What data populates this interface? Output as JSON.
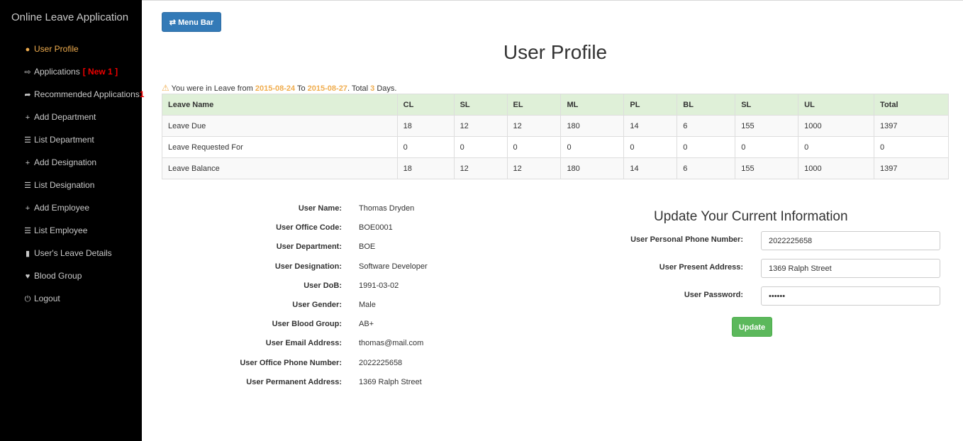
{
  "app": {
    "title": "Online Leave Application"
  },
  "sidebar": {
    "items": [
      {
        "icon": "user-circle-icon",
        "glyph": "●",
        "label": "User Profile",
        "active": true
      },
      {
        "icon": "sign-out-icon",
        "glyph": "⇨",
        "label": "Applications",
        "badge": "[ New 1 ]"
      },
      {
        "icon": "share-icon",
        "glyph": "➦",
        "label": "Recommended Applications",
        "count": "1"
      },
      {
        "icon": "plus-icon",
        "glyph": "+",
        "label": "Add Department"
      },
      {
        "icon": "list-icon",
        "glyph": "☰",
        "label": "List Department"
      },
      {
        "icon": "plus-icon",
        "glyph": "+",
        "label": "Add Designation"
      },
      {
        "icon": "list-icon",
        "glyph": "☰",
        "label": "List Designation"
      },
      {
        "icon": "plus-icon",
        "glyph": "+",
        "label": "Add Employee"
      },
      {
        "icon": "list-icon",
        "glyph": "☰",
        "label": "List Employee"
      },
      {
        "icon": "clipboard-icon",
        "glyph": "▮",
        "label": "User's Leave Details"
      },
      {
        "icon": "heartbeat-icon",
        "glyph": "♥",
        "label": "Blood Group"
      },
      {
        "icon": "power-icon",
        "glyph": "⏻",
        "label": "Logout"
      }
    ]
  },
  "toolbar": {
    "menu_label": "⇄ Menu Bar"
  },
  "page": {
    "title": "User Profile"
  },
  "notice": {
    "prefix": "You were in Leave from ",
    "from": "2015-08-24",
    "mid": " To ",
    "to": "2015-08-27",
    "total_text": ". Total ",
    "days": "3",
    "suffix": " Days."
  },
  "leave_table": {
    "headers": [
      "Leave Name",
      "CL",
      "SL",
      "EL",
      "ML",
      "PL",
      "BL",
      "SL",
      "UL",
      "Total"
    ],
    "rows": [
      [
        "Leave Due",
        "18",
        "12",
        "12",
        "180",
        "14",
        "6",
        "155",
        "1000",
        "1397"
      ],
      [
        "Leave Requested For",
        "0",
        "0",
        "0",
        "0",
        "0",
        "0",
        "0",
        "0",
        "0"
      ],
      [
        "Leave Balance",
        "18",
        "12",
        "12",
        "180",
        "14",
        "6",
        "155",
        "1000",
        "1397"
      ]
    ]
  },
  "profile": [
    {
      "label": "User Name:",
      "value": "Thomas Dryden"
    },
    {
      "label": "User Office Code:",
      "value": "BOE0001"
    },
    {
      "label": "User Department:",
      "value": "BOE"
    },
    {
      "label": "User Designation:",
      "value": "Software Developer"
    },
    {
      "label": "User DoB:",
      "value": "1991-03-02"
    },
    {
      "label": "User Gender:",
      "value": "Male"
    },
    {
      "label": "User Blood Group:",
      "value": "AB+"
    },
    {
      "label": "User Email Address:",
      "value": "thomas@mail.com"
    },
    {
      "label": "User Office Phone Number:",
      "value": "2022225658"
    },
    {
      "label": "User Permanent Address:",
      "value": "1369 Ralph Street"
    }
  ],
  "update_form": {
    "title": "Update Your Current Information",
    "phone_label": "User Personal Phone Number:",
    "phone_value": "2022225658",
    "address_label": "User Present Address:",
    "address_value": "1369 Ralph Street",
    "password_label": "User Password:",
    "password_value": "••••••",
    "submit_label": "Update"
  },
  "colors": {
    "sidebar_bg": "#000000",
    "active": "#f0ad4e",
    "primary": "#337ab7",
    "success": "#5cb85c",
    "table_head": "#dff0d8"
  }
}
